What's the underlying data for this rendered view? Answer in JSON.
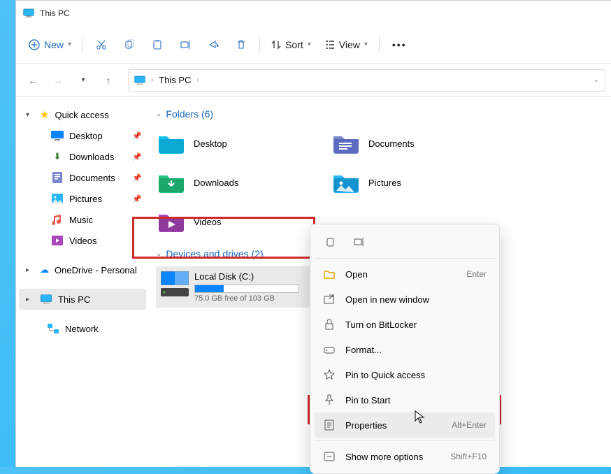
{
  "window": {
    "title": "This PC"
  },
  "toolbar": {
    "new": "New",
    "sort": "Sort",
    "view": "View"
  },
  "breadcrumb": {
    "location": "This PC"
  },
  "sidebar": {
    "quick_access": "Quick access",
    "items": [
      {
        "label": "Desktop"
      },
      {
        "label": "Downloads"
      },
      {
        "label": "Documents"
      },
      {
        "label": "Pictures"
      },
      {
        "label": "Music"
      },
      {
        "label": "Videos"
      }
    ],
    "onedrive": "OneDrive - Personal",
    "this_pc": "This PC",
    "network": "Network"
  },
  "sections": {
    "folders_head": "Folders (6)",
    "drives_head": "Devices and drives (2)"
  },
  "folders": [
    {
      "label": "Desktop"
    },
    {
      "label": "Documents"
    },
    {
      "label": "Downloads"
    },
    {
      "label": "Pictures"
    },
    {
      "label": "Videos"
    }
  ],
  "drive": {
    "label": "Local Disk (C:)",
    "subtitle": "75.0 GB free of 103 GB"
  },
  "context_menu": {
    "open": "Open",
    "open_shortcut": "Enter",
    "open_new": "Open in new window",
    "bitlocker": "Turn on BitLocker",
    "format": "Format...",
    "pin_qa": "Pin to Quick access",
    "pin_start": "Pin to Start",
    "properties": "Properties",
    "properties_shortcut": "Alt+Enter",
    "more": "Show more options",
    "more_shortcut": "Shift+F10"
  }
}
